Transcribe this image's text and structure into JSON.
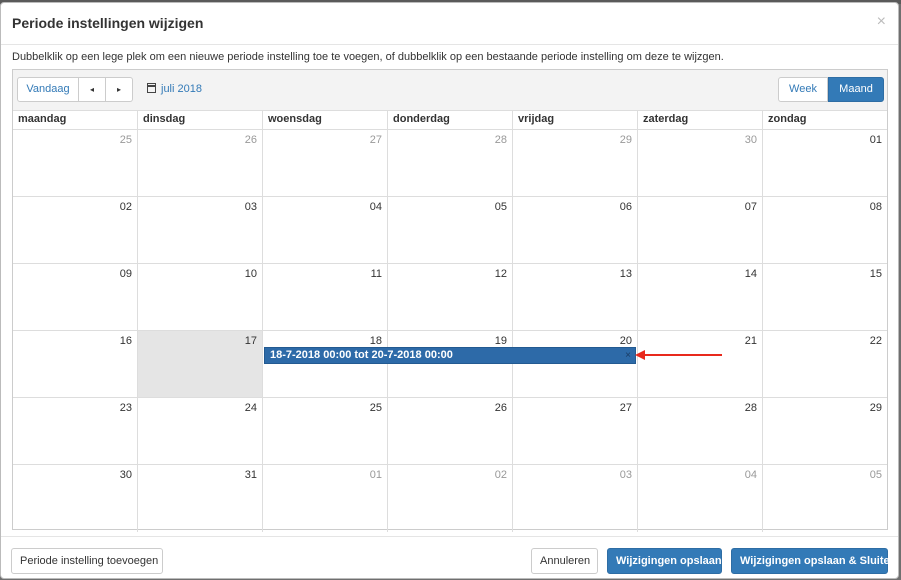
{
  "modal": {
    "title": "Periode instellingen wijzigen",
    "close": "×",
    "instructions": "Dubbelklik op een lege plek om een nieuwe periode instelling toe te voegen, of dubbelklik op een bestaande periode instelling om deze te wijzgen."
  },
  "toolbar": {
    "today_label": "Vandaag",
    "prev_label": "◂",
    "next_label": "▸",
    "current_month": "juli 2018",
    "week_label": "Week",
    "month_label": "Maand"
  },
  "weekdays": [
    "maandag",
    "dinsdag",
    "woensdag",
    "donderdag",
    "vrijdag",
    "zaterdag",
    "zondag"
  ],
  "weeks": [
    [
      "25",
      "26",
      "27",
      "28",
      "29",
      "30",
      "01"
    ],
    [
      "02",
      "03",
      "04",
      "05",
      "06",
      "07",
      "08"
    ],
    [
      "09",
      "10",
      "11",
      "12",
      "13",
      "14",
      "15"
    ],
    [
      "16",
      "17",
      "18",
      "19",
      "20",
      "21",
      "22"
    ],
    [
      "23",
      "24",
      "25",
      "26",
      "27",
      "28",
      "29"
    ],
    [
      "30",
      "31",
      "01",
      "02",
      "03",
      "04",
      "05"
    ]
  ],
  "event": {
    "label": "18-7-2018 00:00 tot 20-7-2018 00:00",
    "remove": "×"
  },
  "colors": {
    "accent": "#337ab7",
    "event": "#2d6aa8",
    "arrow": "#e8291c",
    "today_bg": "#e5e5e5"
  },
  "footer": {
    "add_label": "Periode instelling toevoegen",
    "cancel_label": "Annuleren",
    "save_label": "Wijzigingen opslaan",
    "save_close_label": "Wijzigingen opslaan & Sluiten"
  }
}
